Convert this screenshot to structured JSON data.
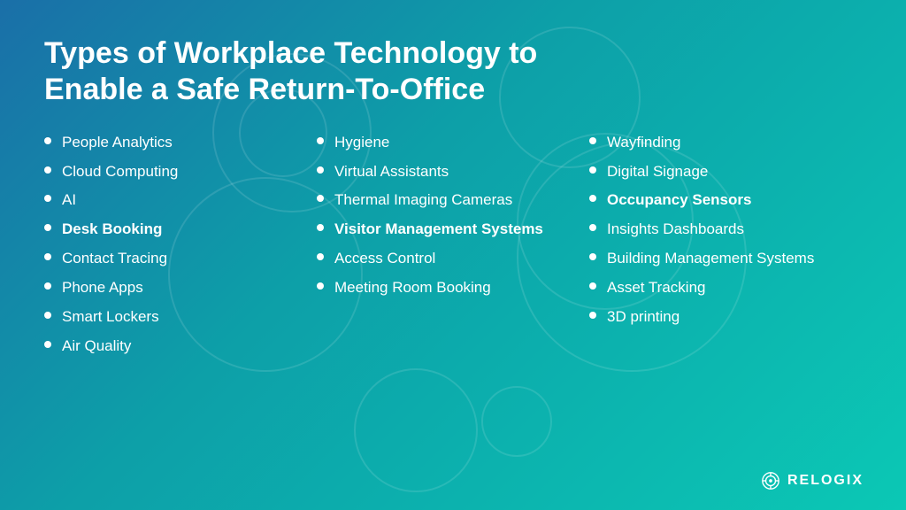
{
  "title": {
    "line1": "Types of Workplace Technology to",
    "line2": "Enable a Safe Return-To-Office"
  },
  "columns": [
    {
      "id": "col1",
      "items": [
        {
          "text": "People Analytics",
          "bold": false
        },
        {
          "text": "Cloud Computing",
          "bold": false
        },
        {
          "text": "AI",
          "bold": false
        },
        {
          "text": "Desk Booking",
          "bold": true
        },
        {
          "text": "Contact Tracing",
          "bold": false
        },
        {
          "text": "Phone Apps",
          "bold": false
        },
        {
          "text": "Smart Lockers",
          "bold": false
        },
        {
          "text": "Air Quality",
          "bold": false
        }
      ]
    },
    {
      "id": "col2",
      "items": [
        {
          "text": "Hygiene",
          "bold": false
        },
        {
          "text": "Virtual Assistants",
          "bold": false
        },
        {
          "text": "Thermal Imaging Cameras",
          "bold": false
        },
        {
          "text": "Visitor Management Systems",
          "bold": true
        },
        {
          "text": "Access Control",
          "bold": false
        },
        {
          "text": "Meeting Room Booking",
          "bold": false
        }
      ]
    },
    {
      "id": "col3",
      "items": [
        {
          "text": "Wayfinding",
          "bold": false
        },
        {
          "text": "Digital Signage",
          "bold": false
        },
        {
          "text": "Occupancy Sensors",
          "bold": true
        },
        {
          "text": "Insights Dashboards",
          "bold": false
        },
        {
          "text": "Building Management Systems",
          "bold": false
        },
        {
          "text": "Asset Tracking",
          "bold": false
        },
        {
          "text": "3D printing",
          "bold": false
        }
      ]
    }
  ],
  "logo": {
    "text": "RELOGIX"
  }
}
